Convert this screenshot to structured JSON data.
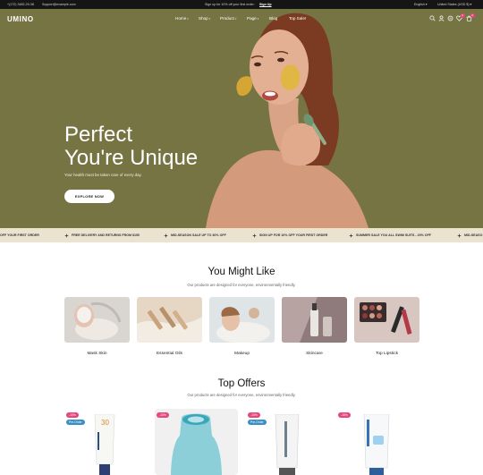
{
  "topbar": {
    "phone": "+(172) 3482-29-38",
    "email": "Support@example.com",
    "promo": "Sign up for 10% off your first order:",
    "signup": "Sign Up",
    "language": "English",
    "currency": "United States (USD $)"
  },
  "header": {
    "logo": "UMINO",
    "nav": [
      {
        "label": "Home",
        "dropdown": true
      },
      {
        "label": "Shop",
        "dropdown": true
      },
      {
        "label": "Product",
        "dropdown": true
      },
      {
        "label": "Page",
        "dropdown": true
      },
      {
        "label": "Blog",
        "dropdown": false
      },
      {
        "label": "Top Sale!",
        "dropdown": false
      }
    ],
    "icons": [
      "search-icon",
      "user-icon",
      "compare-icon",
      "wishlist-icon",
      "cart-icon"
    ],
    "wishlist_count": "0",
    "cart_count": "0",
    "accent": "#e6437a"
  },
  "hero": {
    "title_line1": "Perfect",
    "title_line2": "You're Unique",
    "subtitle": "Your health must be taken care of every day.",
    "button": "EXPLORE NOW",
    "background": "#777444"
  },
  "marquee": {
    "items": [
      "OFF YOUR FIRST ORDER",
      "FREE DELIVERY AND RETURNS FROM $150",
      "MID-SEASON SALE UP TO 30% OFF",
      "SIGN UP FOR 10% OFF YOUR FIRST ORDER",
      "SUMMER SALE YOU ALL SWIM SUITS - 20% OFF",
      "MID-SEASO"
    ],
    "background": "#ebe2cf"
  },
  "might_like": {
    "title": "You Might Like",
    "subtitle": "Our products are designed for everyone, environmentally friendly.",
    "categories": [
      "Mask Skin",
      "Essential Oils",
      "Makeup",
      "Skincare",
      "Top Lipstick"
    ]
  },
  "top_offers": {
    "title": "Top Offers",
    "subtitle": "Our products are designed for everyone, environmentally friendly.",
    "products": [
      {
        "discount": "-10%",
        "tag": "Pre-Order"
      },
      {
        "discount": "-10%",
        "tag": ""
      },
      {
        "discount": "-10%",
        "tag": "Pre-Order"
      },
      {
        "discount": "-15%",
        "tag": ""
      }
    ]
  }
}
